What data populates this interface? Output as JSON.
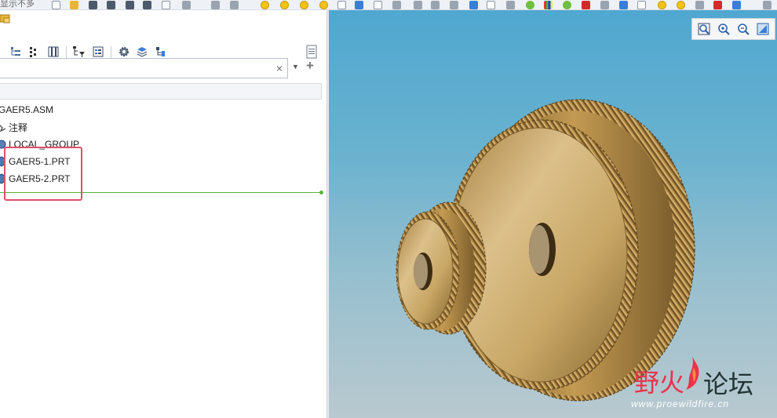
{
  "quick_access": {
    "label": "显示不多"
  },
  "tree": {
    "search": {
      "value": "",
      "clear_glyph": "×",
      "dropdown_glyph": "▼",
      "add_glyph": "+"
    },
    "items": [
      {
        "label": "GAER5.ASM",
        "icon": "assembly-icon"
      },
      {
        "label": "注释",
        "icon": "annotation-icon"
      },
      {
        "label": "LOCAL_GROUP",
        "icon": "group-icon"
      },
      {
        "label": "GAER5-1.PRT",
        "icon": "part-icon"
      },
      {
        "label": "GAER5-2.PRT",
        "icon": "part-icon"
      }
    ]
  },
  "view_toolbar": {
    "buttons": [
      "refit-icon",
      "zoom-in-icon",
      "zoom-out-icon",
      "view-orientation-icon"
    ]
  },
  "watermark": {
    "text_a": "野火",
    "text_b": "论坛",
    "site": "www.proewildfire.cn"
  },
  "colors": {
    "highlight": "#e0506a",
    "insert_line": "#57b33e",
    "gear_gold": "#c9a45c"
  }
}
